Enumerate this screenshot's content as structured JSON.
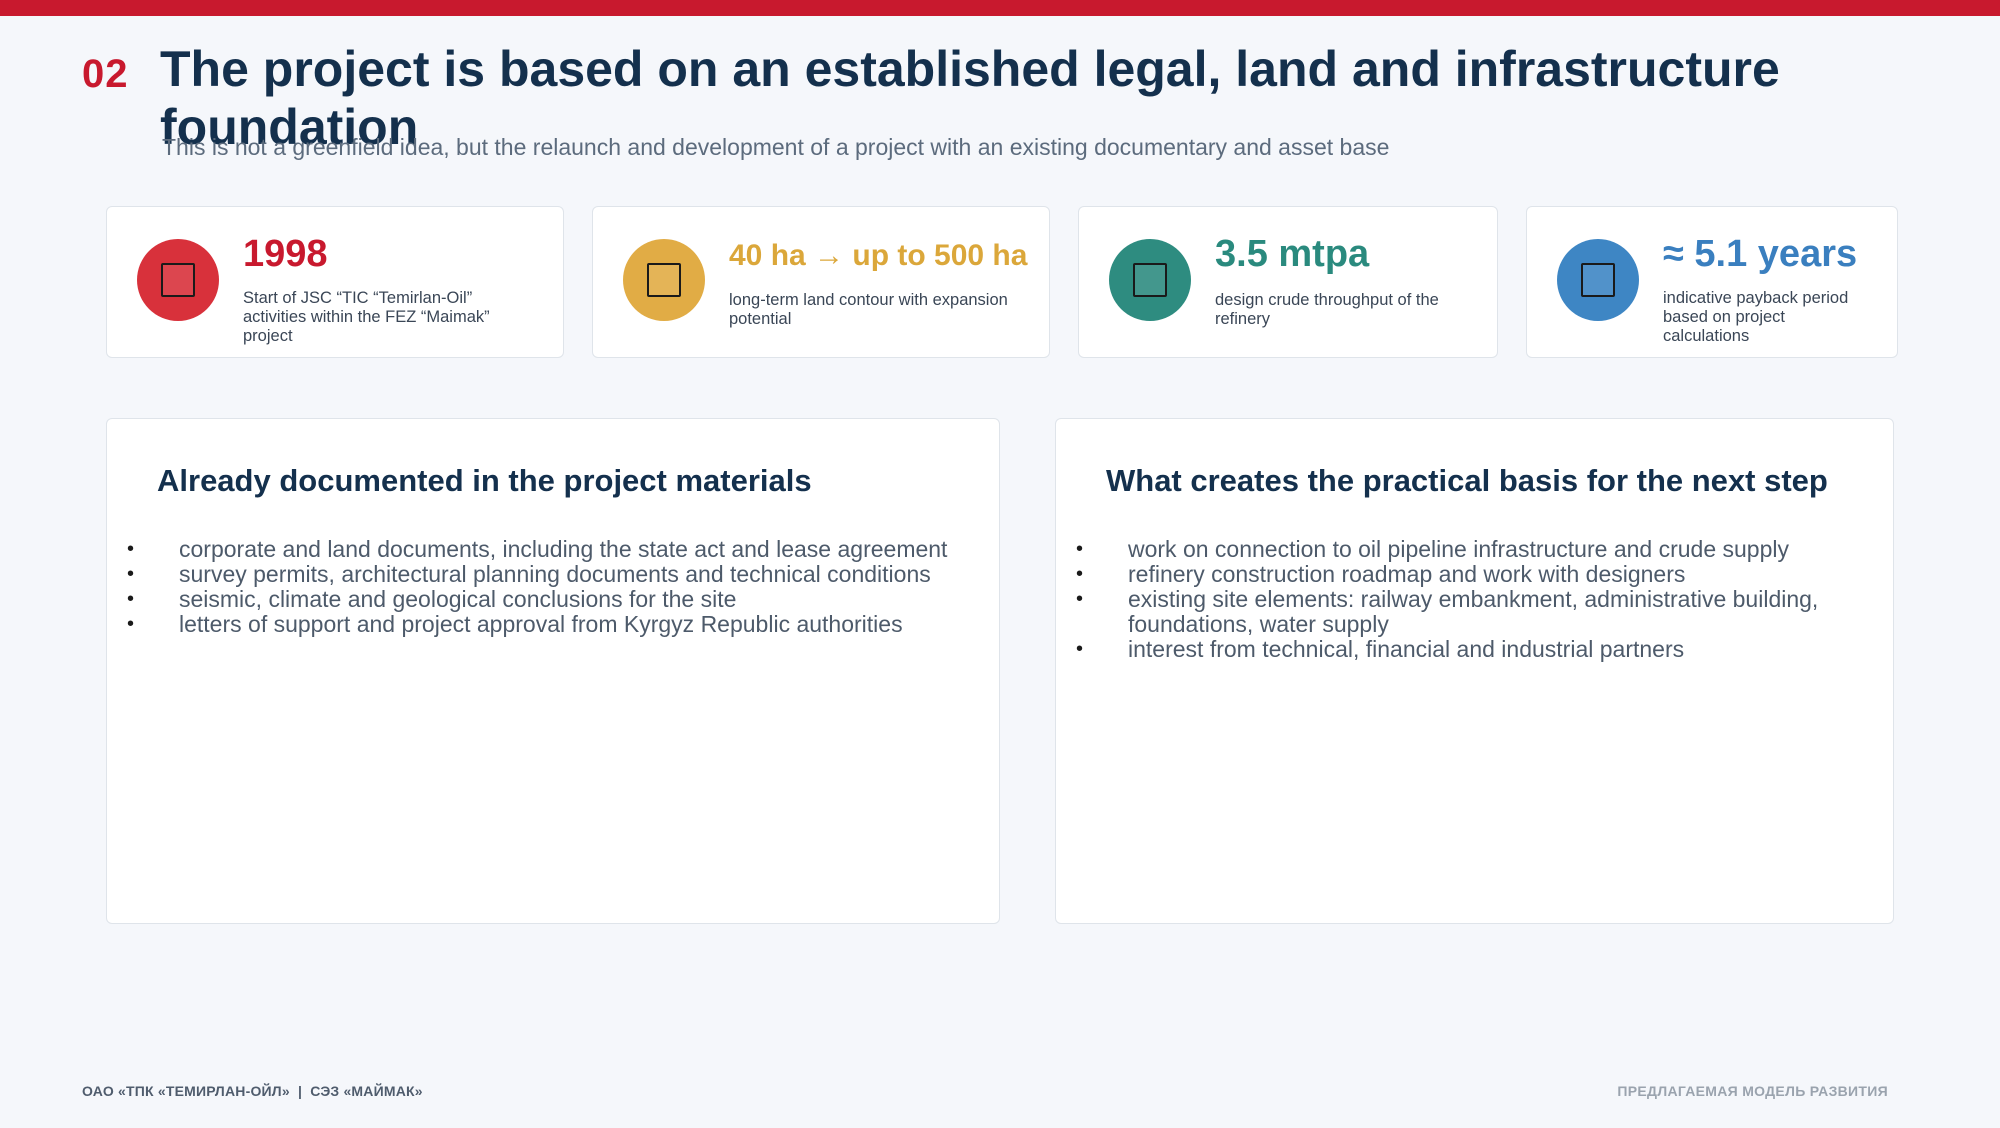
{
  "header": {
    "number": "02",
    "title": "The project is based on an established legal, land and infrastructure foundation",
    "subtitle": "This is not a greenfield idea, but the relaunch and development of a project with an existing documentary and asset base"
  },
  "kpis": [
    {
      "value": "1998",
      "description": "Start of JSC “TIC “Temirlan-Oil” activities within the FEZ “Maimak” project",
      "color": "#c8192e",
      "icon": "square-icon"
    },
    {
      "value": "40 ha → up to 500 ha",
      "description": "long-term land contour with expansion potential",
      "color": "#dba73a",
      "icon": "square-icon"
    },
    {
      "value": "3.5 mtpa",
      "description": "design crude throughput of the refinery",
      "color": "#2a8a7e",
      "icon": "square-icon"
    },
    {
      "value": "≈ 5.1 years",
      "description": "indicative payback period based on project calculations",
      "color": "#3a7fbf",
      "icon": "square-icon"
    }
  ],
  "panels": {
    "documented": {
      "heading": "Already documented in the project materials",
      "items": [
        "corporate and land documents, including the state act and lease agreement",
        "survey permits, architectural planning documents and technical conditions",
        "seismic, climate and geological conclusions for the site",
        "letters of support and project approval from Kyrgyz Republic authorities"
      ]
    },
    "basis": {
      "heading": "What creates the practical basis for the next step",
      "items": [
        "work on connection to oil pipeline infrastructure and crude supply",
        "refinery construction roadmap and work with designers",
        "existing site elements: railway embankment, administrative building, foundations, water supply",
        "interest from technical, financial and industrial partners"
      ]
    }
  },
  "footer": {
    "left": "ОАО «ТПК «ТЕМИРЛАН-ОЙЛ»  |  СЭЗ «МАЙМАК»",
    "right": "ПРЕДЛАГАЕМАЯ МОДЕЛЬ РАЗВИТИЯ"
  },
  "bullet_glyph": "•",
  "colors": {
    "accent_red": "#c8192e",
    "title_navy": "#14304d",
    "background": "#f5f7fb"
  }
}
